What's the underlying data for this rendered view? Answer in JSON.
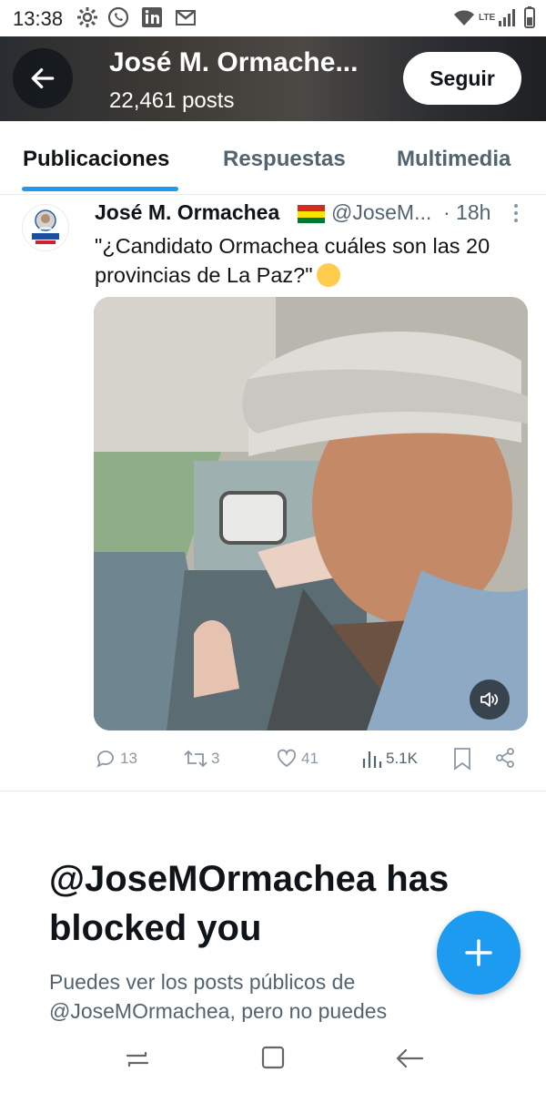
{
  "status_bar": {
    "time": "13:38",
    "network": "LTE"
  },
  "header": {
    "name": "José M. Ormache...",
    "posts": "22,461 posts",
    "follow_label": "Seguir"
  },
  "tabs": [
    {
      "label": "Publicaciones",
      "active": true
    },
    {
      "label": "Respuestas",
      "active": false
    },
    {
      "label": "Multimedia",
      "active": false
    }
  ],
  "tweet": {
    "author": "José M. Ormachea",
    "handle": "@JoseM...",
    "time": "· 18h",
    "text": "\"¿Candidato Ormachea cuáles son las 20 provincias de La Paz?\"",
    "avatar_caption": "ORMACHEA",
    "actions": {
      "replies": "13",
      "retweets": "3",
      "likes": "41",
      "views": "5.1K"
    }
  },
  "blocked": {
    "title": "@JoseMOrmachea has blocked you",
    "description": "Puedes ver los posts públicos de @JoseMOrmachea, pero no puedes"
  },
  "colors": {
    "accent": "#1d9bf0",
    "text": "#0f1419",
    "muted": "#536471"
  },
  "icons": [
    "gear-icon",
    "whatsapp-icon",
    "linkedin-icon",
    "gmail-icon",
    "wifi-icon",
    "signal-icon",
    "battery-icon",
    "back-arrow-icon",
    "flag-icon",
    "more-icon",
    "mute-icon",
    "reply-icon",
    "retweet-icon",
    "like-icon",
    "views-icon",
    "bookmark-icon",
    "share-icon",
    "plus-icon",
    "recents-icon",
    "home-icon",
    "back-icon"
  ]
}
